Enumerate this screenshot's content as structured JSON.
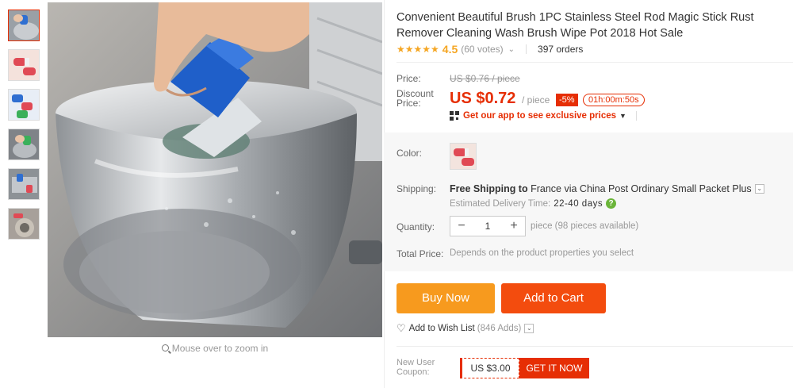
{
  "product": {
    "title": "Convenient Beautiful Brush 1PC Stainless Steel Rod Magic Stick Rust Remover Cleaning Wash Brush Wipe Pot 2018 Hot Sale",
    "stars": "★★★★★",
    "rating": "4.5",
    "votes": "(60 votes)",
    "votes_caret": "⌄",
    "orders": "397 orders"
  },
  "price": {
    "label": "Price:",
    "original": "US $0.76 / piece",
    "discount_label": "Discount Price:",
    "current": "US $0.72",
    "unit": "/ piece",
    "percent_off": "-5%",
    "timer": "01h:00m:50s",
    "app_promo": "Get our app to see exclusive prices",
    "app_caret": "▼"
  },
  "options": {
    "color_label": "Color:",
    "shipping_label": "Shipping:",
    "free_shipping": "Free Shipping to",
    "shipping_dest": "France via China Post Ordinary Small Packet Plus",
    "dd_icon": "⌄",
    "delivery_label": "Estimated Delivery Time:",
    "delivery_days": "22-40  days",
    "help_icon": "?",
    "quantity_label": "Quantity:",
    "quantity_value": "1",
    "minus": "−",
    "plus": "+",
    "quantity_info": "piece (98 pieces available)",
    "total_label": "Total Price:",
    "total_info": "Depends on the product properties you select"
  },
  "actions": {
    "buy_now": "Buy Now",
    "add_to_cart": "Add to Cart",
    "heart_icon": "♡",
    "wishlist": "Add to Wish List",
    "wishlist_count": "(846 Adds)",
    "wish_caret": "⌄"
  },
  "coupon": {
    "label": "New User Coupon:",
    "amount": "US $3.00",
    "cta": "GET IT NOW"
  },
  "gallery": {
    "zoom_hint": "Mouse over to zoom in"
  },
  "colors": {
    "accent": "#e62e04",
    "buy_now": "#f79a1e",
    "add_to_cart": "#f34c0e",
    "star": "#f5a623"
  }
}
